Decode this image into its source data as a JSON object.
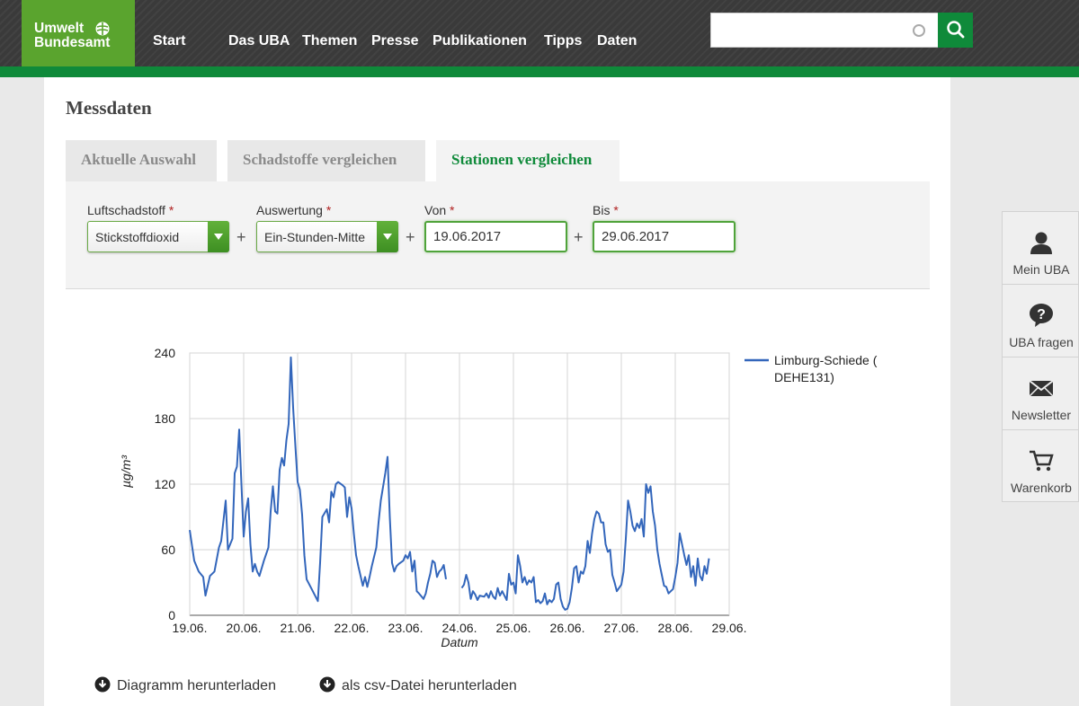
{
  "header": {
    "logo_line1": "Umwelt",
    "logo_line2": "Bundesamt",
    "nav": [
      "Start",
      "Das UBA",
      "Themen",
      "Presse",
      "Publikationen",
      "Tipps",
      "Daten"
    ],
    "search_value": "",
    "search_icon": "magnifier-icon",
    "clear_icon": "clear-circle-icon"
  },
  "colors": {
    "brand_green": "#0f8a3a",
    "logo_green": "#5aa42e",
    "series_blue": "#3366bb",
    "header_dark": "#3a3a3a"
  },
  "page": {
    "title": "Messdaten"
  },
  "tabs": [
    {
      "label": "Aktuelle Auswahl",
      "active": false
    },
    {
      "label": "Schadstoffe vergleichen",
      "active": false
    },
    {
      "label": "Stationen vergleichen",
      "active": true
    }
  ],
  "form": {
    "pollutant": {
      "label": "Luftschadstoff",
      "value": "Stickstoffdioxid"
    },
    "evaluation": {
      "label": "Auswertung",
      "value": "Ein-Stunden-Mitte"
    },
    "from": {
      "label": "Von",
      "value": "19.06.2017"
    },
    "to": {
      "label": "Bis",
      "value": "29.06.2017"
    },
    "required_mark": "*",
    "plus": "+"
  },
  "chart_data": {
    "type": "line",
    "xlabel": "Datum",
    "ylabel": "µg/m³",
    "ylim": [
      0,
      240
    ],
    "yticks": [
      0,
      60,
      120,
      180,
      240
    ],
    "x_tick_labels": [
      "19.06.",
      "20.06.",
      "21.06.",
      "22.06.",
      "23.06.",
      "24.06.",
      "25.06.",
      "26.06.",
      "27.06.",
      "28.06.",
      "29.06."
    ],
    "grid": true,
    "legend_position": "top-right",
    "series": [
      {
        "name": "Limburg-Schiede ( DEHE131)",
        "color": "#3366bb",
        "points": [
          [
            "19.06. 00:00",
            78
          ],
          [
            "19.06. 02:00",
            50
          ],
          [
            "19.06. 04:00",
            40
          ],
          [
            "19.06. 06:00",
            35
          ],
          [
            "19.06. 07:00",
            18
          ],
          [
            "19.06. 09:00",
            36
          ],
          [
            "19.06. 11:00",
            40
          ],
          [
            "19.06. 13:00",
            62
          ],
          [
            "19.06. 14:00",
            68
          ],
          [
            "19.06. 16:00",
            105
          ],
          [
            "19.06. 17:00",
            60
          ],
          [
            "19.06. 19:00",
            70
          ],
          [
            "19.06. 20:00",
            130
          ],
          [
            "19.06. 21:00",
            136
          ],
          [
            "19.06. 22:00",
            170
          ],
          [
            "19.06. 23:00",
            120
          ],
          [
            "20.06. 00:00",
            72
          ],
          [
            "20.06. 01:00",
            95
          ],
          [
            "20.06. 02:00",
            107
          ],
          [
            "20.06. 03:00",
            65
          ],
          [
            "20.06. 04:00",
            40
          ],
          [
            "20.06. 05:00",
            47
          ],
          [
            "20.06. 06:00",
            40
          ],
          [
            "20.06. 07:00",
            36
          ],
          [
            "20.06. 09:00",
            50
          ],
          [
            "20.06. 11:00",
            62
          ],
          [
            "20.06. 12:00",
            95
          ],
          [
            "20.06. 13:00",
            118
          ],
          [
            "20.06. 14:00",
            95
          ],
          [
            "20.06. 15:00",
            93
          ],
          [
            "20.06. 16:00",
            133
          ],
          [
            "20.06. 17:00",
            144
          ],
          [
            "20.06. 18:00",
            137
          ],
          [
            "20.06. 19:00",
            160
          ],
          [
            "20.06. 20:00",
            175
          ],
          [
            "20.06. 21:00",
            236
          ],
          [
            "20.06. 22:00",
            190
          ],
          [
            "20.06. 23:00",
            155
          ],
          [
            "21.06. 00:00",
            122
          ],
          [
            "21.06. 01:00",
            115
          ],
          [
            "21.06. 02:00",
            92
          ],
          [
            "21.06. 03:00",
            55
          ],
          [
            "21.06. 04:00",
            33
          ],
          [
            "21.06. 06:00",
            25
          ],
          [
            "21.06. 08:00",
            17
          ],
          [
            "21.06. 09:00",
            13
          ],
          [
            "21.06. 10:00",
            48
          ],
          [
            "21.06. 11:00",
            90
          ],
          [
            "21.06. 13:00",
            97
          ],
          [
            "21.06. 14:00",
            85
          ],
          [
            "21.06. 15:00",
            113
          ],
          [
            "21.06. 16:00",
            108
          ],
          [
            "21.06. 17:00",
            120
          ],
          [
            "21.06. 18:00",
            122
          ],
          [
            "21.06. 20:00",
            119
          ],
          [
            "21.06. 21:00",
            117
          ],
          [
            "21.06. 22:00",
            90
          ],
          [
            "21.06. 23:00",
            108
          ],
          [
            "22.06. 00:00",
            98
          ],
          [
            "22.06. 01:00",
            75
          ],
          [
            "22.06. 02:00",
            55
          ],
          [
            "22.06. 03:00",
            45
          ],
          [
            "22.06. 05:00",
            27
          ],
          [
            "22.06. 06:00",
            35
          ],
          [
            "22.06. 07:00",
            26
          ],
          [
            "22.06. 08:00",
            35
          ],
          [
            "22.06. 09:00",
            45
          ],
          [
            "22.06. 11:00",
            62
          ],
          [
            "22.06. 12:00",
            85
          ],
          [
            "22.06. 13:00",
            105
          ],
          [
            "22.06. 15:00",
            130
          ],
          [
            "22.06. 16:00",
            145
          ],
          [
            "22.06. 17:00",
            90
          ],
          [
            "22.06. 18:00",
            48
          ],
          [
            "22.06. 19:00",
            40
          ],
          [
            "22.06. 20:00",
            45
          ],
          [
            "22.06. 21:00",
            47
          ],
          [
            "22.06. 23:00",
            50
          ],
          [
            "23.06. 00:00",
            55
          ],
          [
            "23.06. 01:00",
            52
          ],
          [
            "23.06. 02:00",
            58
          ],
          [
            "23.06. 03:00",
            40
          ],
          [
            "23.06. 04:00",
            50
          ],
          [
            "23.06. 05:00",
            22
          ],
          [
            "23.06. 06:00",
            20
          ],
          [
            "23.06. 08:00",
            15
          ],
          [
            "23.06. 09:00",
            20
          ],
          [
            "23.06. 10:00",
            30
          ],
          [
            "23.06. 11:00",
            38
          ],
          [
            "23.06. 12:00",
            50
          ],
          [
            "23.06. 13:00",
            48
          ],
          [
            "23.06. 14:00",
            35
          ],
          [
            "23.06. 15:00",
            40
          ],
          [
            "23.06. 16:00",
            42
          ],
          [
            "23.06. 17:00",
            46
          ],
          [
            "23.06. 18:00",
            33
          ],
          null,
          [
            "24.06. 01:00",
            25
          ],
          [
            "24.06. 02:00",
            28
          ],
          [
            "24.06. 03:00",
            37
          ],
          [
            "24.06. 04:00",
            30
          ],
          [
            "24.06. 05:00",
            15
          ],
          [
            "24.06. 06:00",
            22
          ],
          [
            "24.06. 07:00",
            19
          ],
          [
            "24.06. 08:00",
            14
          ],
          [
            "24.06. 09:00",
            18
          ],
          [
            "24.06. 11:00",
            17
          ],
          [
            "24.06. 12:00",
            20
          ],
          [
            "24.06. 13:00",
            16
          ],
          [
            "24.06. 14:00",
            22
          ],
          [
            "24.06. 15:00",
            17
          ],
          [
            "24.06. 16:00",
            15
          ],
          [
            "24.06. 17:00",
            25
          ],
          [
            "24.06. 18:00",
            18
          ],
          [
            "24.06. 19:00",
            22
          ],
          [
            "24.06. 20:00",
            18
          ],
          [
            "24.06. 21:00",
            14
          ],
          [
            "24.06. 22:00",
            38
          ],
          [
            "24.06. 23:00",
            28
          ],
          [
            "25.06. 00:00",
            30
          ],
          [
            "25.06. 01:00",
            20
          ],
          [
            "25.06. 02:00",
            55
          ],
          [
            "25.06. 03:00",
            45
          ],
          [
            "25.06. 04:00",
            30
          ],
          [
            "25.06. 05:00",
            35
          ],
          [
            "25.06. 06:00",
            28
          ],
          [
            "25.06. 07:00",
            32
          ],
          [
            "25.06. 08:00",
            30
          ],
          [
            "25.06. 09:00",
            35
          ],
          [
            "25.06. 10:00",
            12
          ],
          [
            "25.06. 11:00",
            14
          ],
          [
            "25.06. 12:00",
            11
          ],
          [
            "25.06. 13:00",
            13
          ],
          [
            "25.06. 14:00",
            20
          ],
          [
            "25.06. 15:00",
            10
          ],
          [
            "25.06. 16:00",
            14
          ],
          [
            "25.06. 17:00",
            12
          ],
          [
            "25.06. 18:00",
            15
          ],
          [
            "25.06. 19:00",
            28
          ],
          [
            "25.06. 20:00",
            30
          ],
          [
            "25.06. 21:00",
            15
          ],
          [
            "25.06. 22:00",
            8
          ],
          [
            "25.06. 23:00",
            5
          ],
          [
            "26.06. 00:00",
            6
          ],
          [
            "26.06. 01:00",
            12
          ],
          [
            "26.06. 02:00",
            25
          ],
          [
            "26.06. 03:00",
            43
          ],
          [
            "26.06. 04:00",
            45
          ],
          [
            "26.06. 05:00",
            30
          ],
          [
            "26.06. 06:00",
            40
          ],
          [
            "26.06. 07:00",
            38
          ],
          [
            "26.06. 08:00",
            45
          ],
          [
            "26.06. 09:00",
            68
          ],
          [
            "26.06. 10:00",
            57
          ],
          [
            "26.06. 11:00",
            75
          ],
          [
            "26.06. 12:00",
            88
          ],
          [
            "26.06. 13:00",
            95
          ],
          [
            "26.06. 14:00",
            93
          ],
          [
            "26.06. 15:00",
            85
          ],
          [
            "26.06. 16:00",
            85
          ],
          [
            "26.06. 17:00",
            65
          ],
          [
            "26.06. 18:00",
            58
          ],
          [
            "26.06. 19:00",
            60
          ],
          [
            "26.06. 20:00",
            37
          ],
          [
            "26.06. 21:00",
            30
          ],
          [
            "26.06. 22:00",
            22
          ],
          [
            "26.06. 23:00",
            25
          ],
          [
            "27.06. 00:00",
            28
          ],
          [
            "27.06. 01:00",
            40
          ],
          [
            "27.06. 02:00",
            70
          ],
          [
            "27.06. 03:00",
            105
          ],
          [
            "27.06. 04:00",
            95
          ],
          [
            "27.06. 05:00",
            82
          ],
          [
            "27.06. 06:00",
            77
          ],
          [
            "27.06. 07:00",
            84
          ],
          [
            "27.06. 08:00",
            80
          ],
          [
            "27.06. 09:00",
            88
          ],
          [
            "27.06. 10:00",
            72
          ],
          [
            "27.06. 11:00",
            120
          ],
          [
            "27.06. 12:00",
            112
          ],
          [
            "27.06. 13:00",
            118
          ],
          [
            "27.06. 14:00",
            95
          ],
          [
            "27.06. 15:00",
            82
          ],
          [
            "27.06. 16:00",
            60
          ],
          [
            "27.06. 17:00",
            47
          ],
          [
            "27.06. 18:00",
            37
          ],
          [
            "27.06. 19:00",
            27
          ],
          [
            "27.06. 20:00",
            26
          ],
          [
            "27.06. 21:00",
            20
          ],
          [
            "27.06. 22:00",
            22
          ],
          [
            "27.06. 23:00",
            24
          ],
          [
            "28.06. 00:00",
            35
          ],
          [
            "28.06. 01:00",
            48
          ],
          [
            "28.06. 02:00",
            75
          ],
          [
            "28.06. 03:00",
            65
          ],
          [
            "28.06. 04:00",
            55
          ],
          [
            "28.06. 05:00",
            46
          ],
          [
            "28.06. 06:00",
            55
          ],
          [
            "28.06. 07:00",
            35
          ],
          [
            "28.06. 08:00",
            45
          ],
          [
            "28.06. 09:00",
            27
          ],
          [
            "28.06. 10:00",
            52
          ],
          [
            "28.06. 11:00",
            36
          ],
          [
            "28.06. 12:00",
            32
          ],
          [
            "28.06. 13:00",
            45
          ],
          [
            "28.06. 14:00",
            38
          ],
          [
            "28.06. 15:00",
            52
          ]
        ]
      }
    ]
  },
  "downloads": [
    {
      "label": "Diagramm herunterladen",
      "icon": "download-icon"
    },
    {
      "label": "als csv-Datei herunterladen",
      "icon": "download-icon"
    }
  ],
  "sidebar": [
    {
      "label": "Mein UBA",
      "icon": "user-icon"
    },
    {
      "label": "UBA fragen",
      "icon": "question-bubble-icon"
    },
    {
      "label": "Newsletter",
      "icon": "envelope-icon"
    },
    {
      "label": "Warenkorb",
      "icon": "cart-icon"
    }
  ]
}
